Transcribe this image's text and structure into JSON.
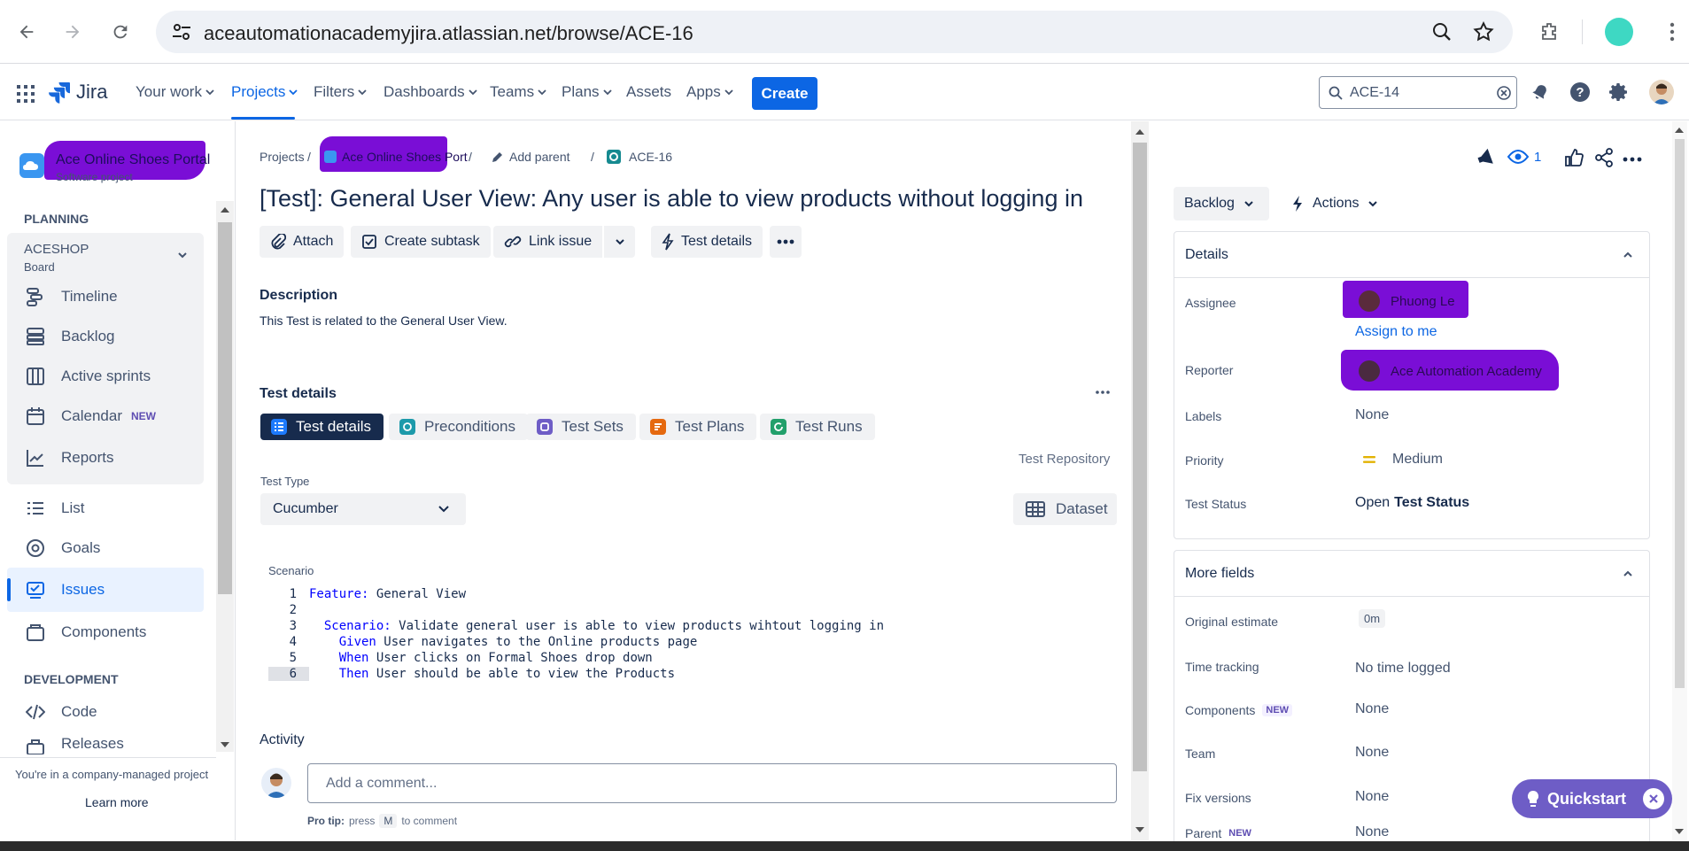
{
  "browser": {
    "url": "aceautomationacademyjira.atlassian.net/browse/ACE-16"
  },
  "topnav": {
    "product": "Jira",
    "items": [
      "Your work",
      "Projects",
      "Filters",
      "Dashboards",
      "Teams",
      "Plans",
      "Assets",
      "Apps"
    ],
    "create_label": "Create",
    "search_value": "ACE-14"
  },
  "sidebar": {
    "project_name": "Ace Online Shoes Portal",
    "project_type": "Software project",
    "planning_label": "PLANNING",
    "board_name": "ACESHOP",
    "board_sub": "Board",
    "board_items": [
      {
        "label": "Timeline",
        "icon": "timeline-icon"
      },
      {
        "label": "Backlog",
        "icon": "backlog-icon"
      },
      {
        "label": "Active sprints",
        "icon": "board-icon"
      },
      {
        "label": "Calendar",
        "icon": "calendar-icon",
        "badge": "NEW"
      },
      {
        "label": "Reports",
        "icon": "reports-icon"
      }
    ],
    "items": [
      {
        "label": "List",
        "icon": "list-icon"
      },
      {
        "label": "Goals",
        "icon": "goals-icon"
      },
      {
        "label": "Issues",
        "icon": "issues-icon",
        "active": true
      },
      {
        "label": "Components",
        "icon": "components-icon"
      }
    ],
    "development_label": "DEVELOPMENT",
    "dev_items": [
      {
        "label": "Code",
        "icon": "code-icon"
      },
      {
        "label": "Releases",
        "icon": "releases-icon"
      }
    ],
    "footer_text": "You're in a company-managed project",
    "learn_more": "Learn more"
  },
  "breadcrumb": {
    "projects": "Projects",
    "project": "Ace Online Shoes Port",
    "add_parent": "Add parent",
    "issue_key": "ACE-16"
  },
  "issue": {
    "title": "[Test]: General User View: Any user is able to view products without logging in",
    "toolbar": {
      "attach": "Attach",
      "create_subtask": "Create subtask",
      "link_issue": "Link issue",
      "test_details": "Test details"
    },
    "description_heading": "Description",
    "description": "This Test is related to the General User View.",
    "test_details_heading": "Test details",
    "tabs": [
      "Test details",
      "Preconditions",
      "Test Sets",
      "Test Plans",
      "Test Runs"
    ],
    "test_repository": "Test Repository",
    "test_type_label": "Test Type",
    "test_type_value": "Cucumber",
    "dataset_label": "Dataset",
    "scenario_label": "Scenario",
    "scenario_lines": [
      {
        "n": "1",
        "kw": "Feature:",
        "text": " General View",
        "indent": ""
      },
      {
        "n": "2",
        "kw": "",
        "text": "",
        "indent": ""
      },
      {
        "n": "3",
        "kw": "Scenario:",
        "text": " Validate general user is able to view products wihtout logging in",
        "indent": "  "
      },
      {
        "n": "4",
        "kw": "Given",
        "text": " User navigates to the Online products page",
        "indent": "    "
      },
      {
        "n": "5",
        "kw": "When",
        "text": " User clicks on Formal Shoes drop down",
        "indent": "    "
      },
      {
        "n": "6",
        "kw": "Then",
        "text": " User should be able to view the Products",
        "indent": "    "
      }
    ],
    "activity_heading": "Activity",
    "comment_placeholder": "Add a comment...",
    "pro_tip_label": "Pro tip:",
    "pro_tip_press": "press",
    "pro_tip_key": "M",
    "pro_tip_rest": "to comment"
  },
  "right_panel": {
    "watch_count": "1",
    "status_button": "Backlog",
    "actions_button": "Actions",
    "details_heading": "Details",
    "fields": [
      {
        "label": "Assignee",
        "value": "Phuong Le"
      },
      {
        "label": "Reporter",
        "value": "Ace Automation Academy"
      },
      {
        "label": "Labels",
        "value": "None"
      },
      {
        "label": "Priority",
        "value": "Medium"
      },
      {
        "label": "Test Status",
        "value_prefix": "Open",
        "value": "Test Status"
      }
    ],
    "assign_to_me": "Assign to me",
    "more_fields_heading": "More fields",
    "more_fields": [
      {
        "label": "Original estimate",
        "value": "0m"
      },
      {
        "label": "Time tracking",
        "value": "No time logged"
      },
      {
        "label": "Components",
        "value": "None",
        "badge": "NEW"
      },
      {
        "label": "Team",
        "value": "None"
      },
      {
        "label": "Fix versions",
        "value": "None"
      },
      {
        "label": "Parent",
        "value": "None",
        "badge": "NEW"
      }
    ]
  },
  "quickstart": {
    "label": "Quickstart"
  },
  "colors": {
    "brand": "#0c66e4",
    "redaction": "#7a0ed6",
    "quickstart": "#6e5dc6"
  }
}
